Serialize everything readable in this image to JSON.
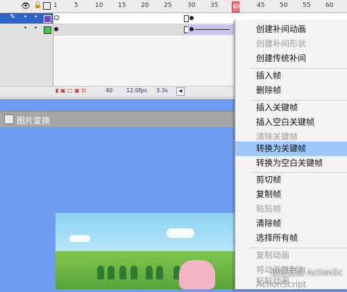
{
  "timeline": {
    "ruler_numbers": [
      "1",
      "5",
      "10",
      "15",
      "20",
      "25",
      "30",
      "35",
      "40",
      "45",
      "50",
      "55",
      "60"
    ],
    "playhead_label": "40",
    "status": {
      "frame": "40",
      "fps": "12.0fps",
      "time": "3.3s"
    }
  },
  "panel": {
    "title": "图片变换"
  },
  "menu": {
    "items": [
      {
        "label": "创建补间动画",
        "enabled": true
      },
      {
        "label": "创建补间形状",
        "enabled": false
      },
      {
        "label": "创建传统补间",
        "enabled": true
      },
      {
        "label": "插入帧",
        "enabled": true
      },
      {
        "label": "删除帧",
        "enabled": true
      },
      {
        "label": "插入关键帧",
        "enabled": true
      },
      {
        "label": "插入空白关键帧",
        "enabled": true
      },
      {
        "label": "清除关键帧",
        "enabled": false
      },
      {
        "label": "转换为关键帧",
        "enabled": true,
        "highlighted": true
      },
      {
        "label": "转换为空白关键帧",
        "enabled": true
      },
      {
        "label": "剪切帧",
        "enabled": true
      },
      {
        "label": "复制帧",
        "enabled": true
      },
      {
        "label": "粘贴帧",
        "enabled": false
      },
      {
        "label": "清除帧",
        "enabled": true
      },
      {
        "label": "选择所有帧",
        "enabled": true
      },
      {
        "label": "复制动画",
        "enabled": false
      },
      {
        "label": "将动画复制为 ActionScript",
        "enabled": false
      },
      {
        "label": "粘贴动画",
        "enabled": false
      }
    ]
  },
  "watermark": "迅捷复制 ActionSc",
  "colors": {
    "menu_highlight": "#9ec8f7",
    "stage_bg": "#6f9cf3",
    "layer1_color": "#7b3fd1",
    "layer2_color": "#45c845"
  }
}
